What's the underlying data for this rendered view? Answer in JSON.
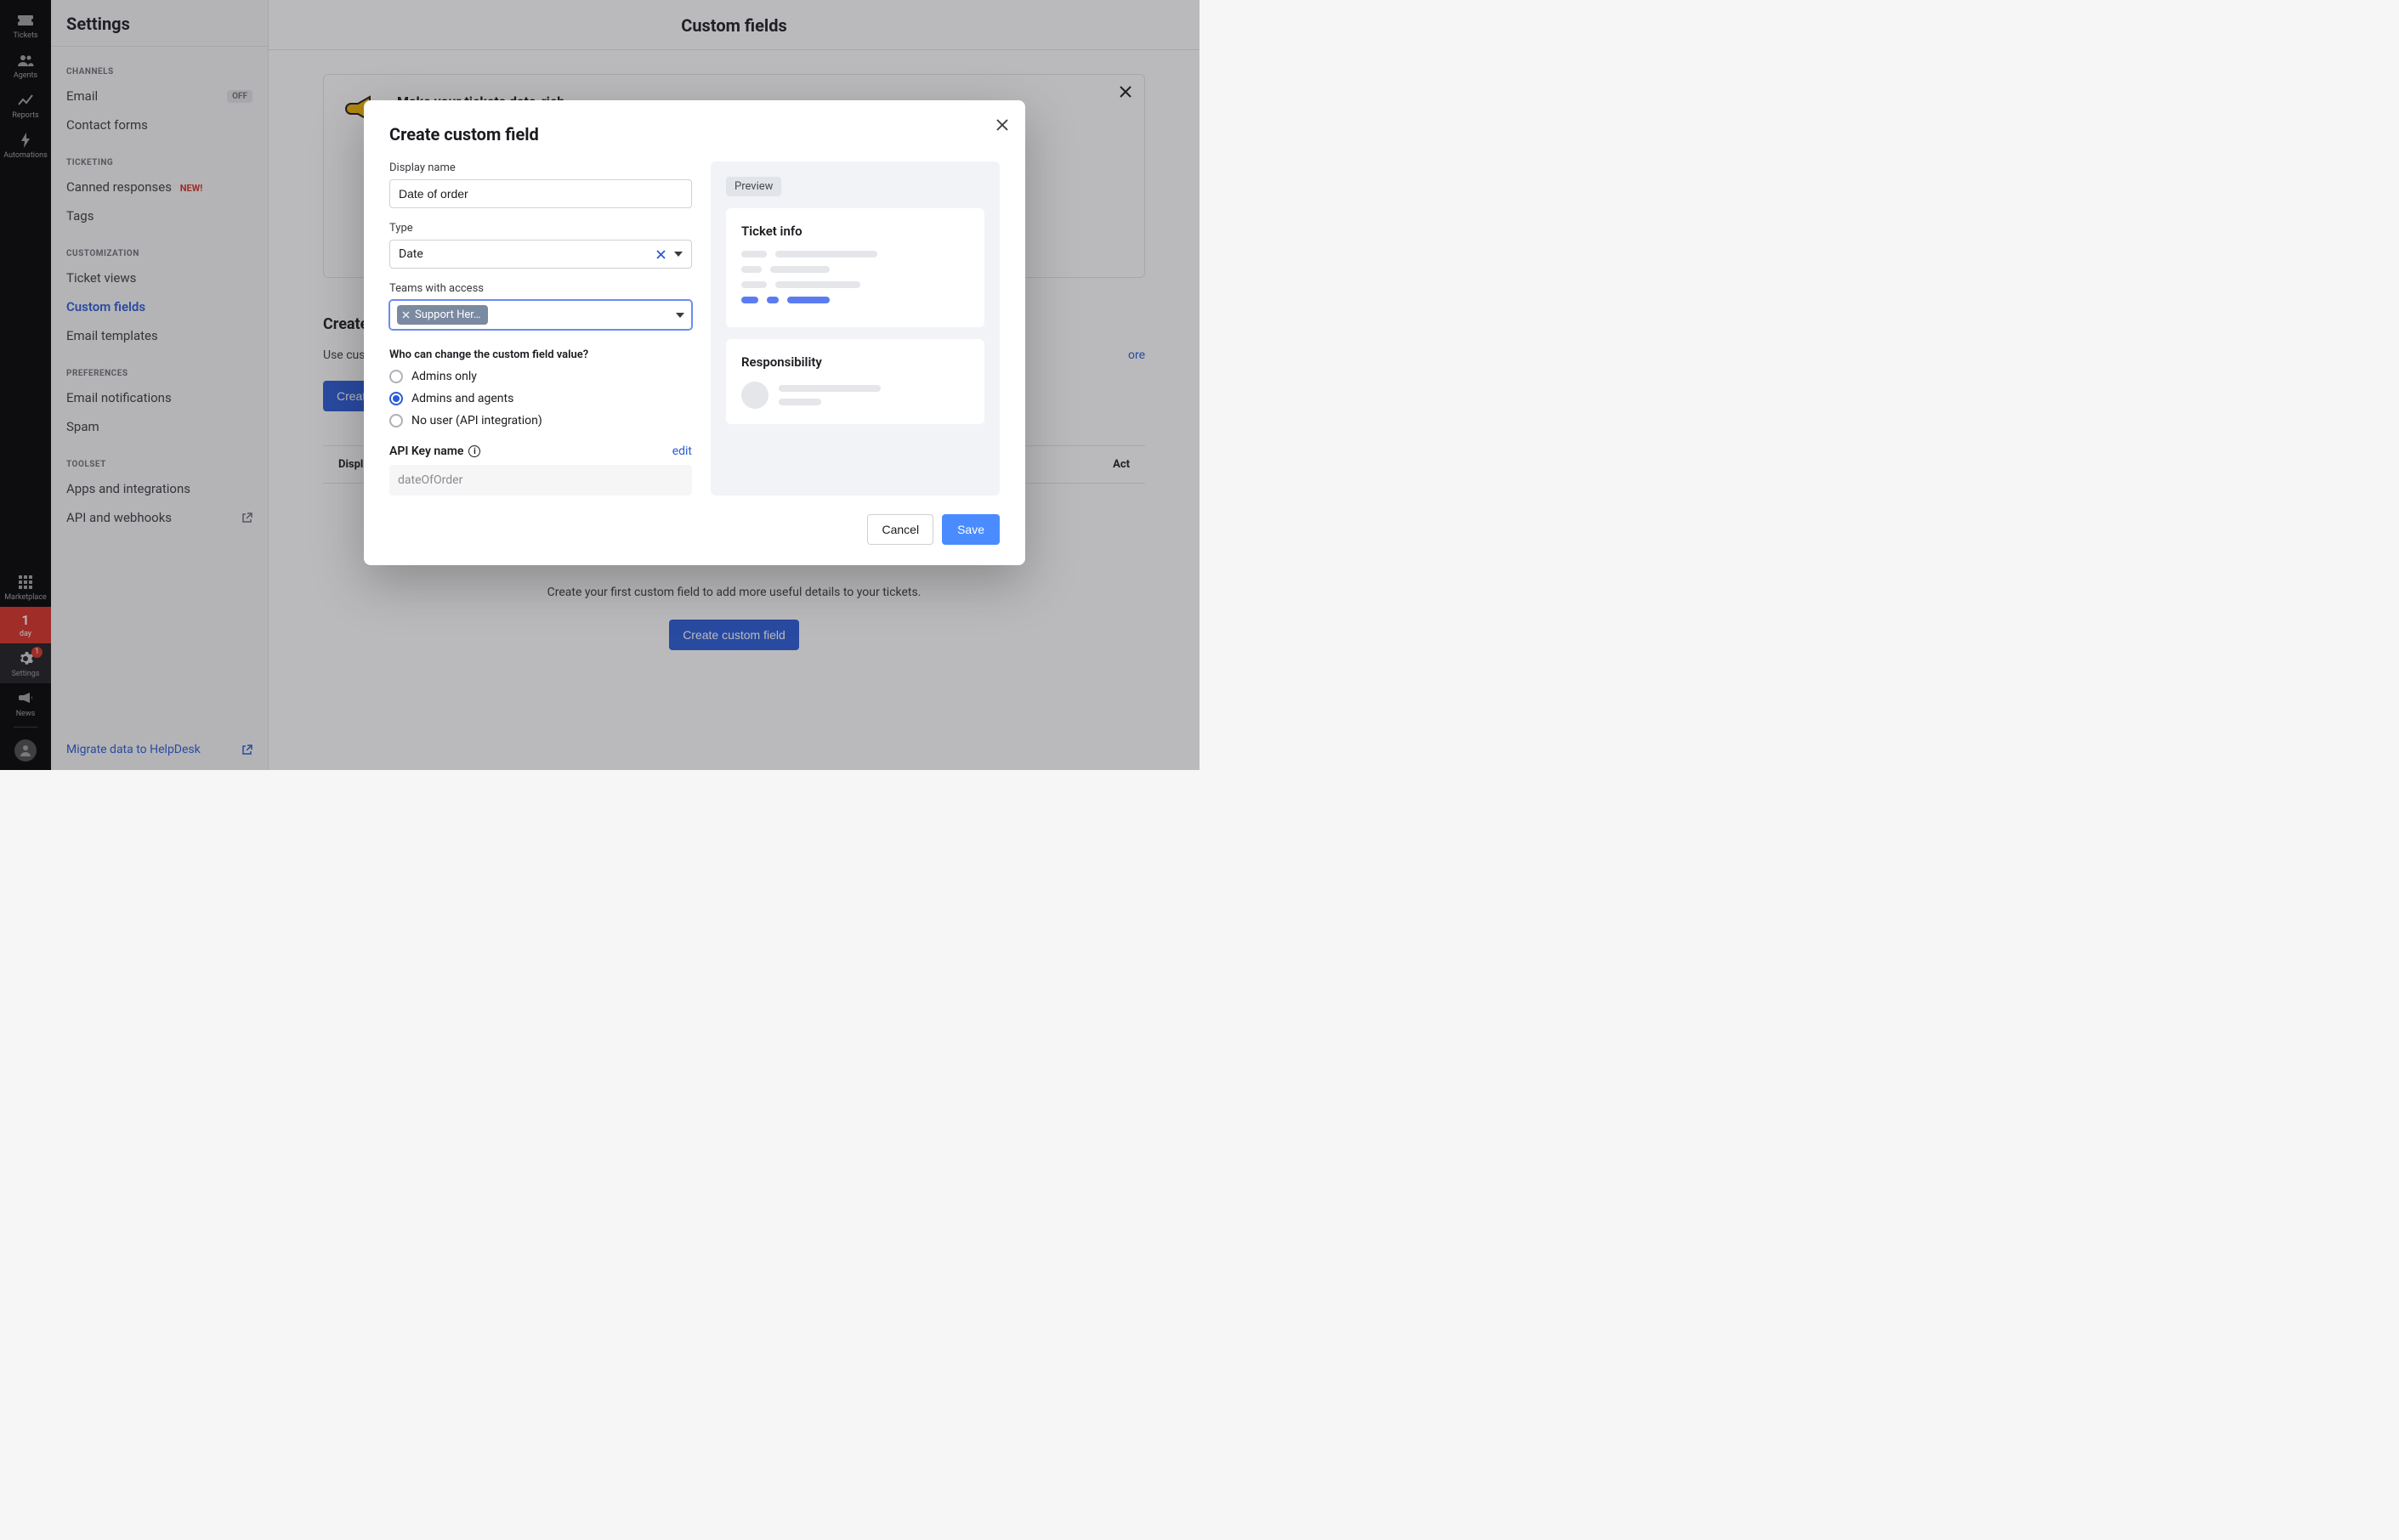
{
  "rail": {
    "items": [
      {
        "label": "Tickets"
      },
      {
        "label": "Agents"
      },
      {
        "label": "Reports"
      },
      {
        "label": "Automations"
      }
    ],
    "marketplace": "Marketplace",
    "trial_count": "1",
    "trial_unit": "day",
    "settings": "Settings",
    "settings_badge": "1",
    "news": "News"
  },
  "sidebar": {
    "title": "Settings",
    "groups": {
      "channels": {
        "label": "CHANNELS",
        "items": [
          {
            "label": "Email",
            "badge_off": "OFF"
          },
          {
            "label": "Contact forms"
          }
        ]
      },
      "ticketing": {
        "label": "TICKETING",
        "items": [
          {
            "label": "Canned responses",
            "badge_new": "NEW!"
          },
          {
            "label": "Tags"
          }
        ]
      },
      "customization": {
        "label": "CUSTOMIZATION",
        "items": [
          {
            "label": "Ticket views"
          },
          {
            "label": "Custom fields"
          },
          {
            "label": "Email templates"
          }
        ]
      },
      "preferences": {
        "label": "PREFERENCES",
        "items": [
          {
            "label": "Email notifications"
          },
          {
            "label": "Spam"
          }
        ]
      },
      "toolset": {
        "label": "TOOLSET",
        "items": [
          {
            "label": "Apps and integrations"
          },
          {
            "label": "API and webhooks"
          }
        ]
      }
    },
    "footer": "Migrate data to HelpDesk"
  },
  "main": {
    "title": "Custom fields",
    "banner": {
      "title": "Make your tickets data-rich"
    },
    "section_title": "Create c",
    "section_desc": "Use custo",
    "learn_more": "ore",
    "create_btn": "Create",
    "table": {
      "col1": "Displ",
      "col2": "Act"
    },
    "empty": {
      "text": "Create your first custom field to add more useful details to your tickets.",
      "btn": "Create custom field"
    }
  },
  "modal": {
    "title": "Create custom field",
    "display_name_label": "Display name",
    "display_name_value": "Date of order",
    "type_label": "Type",
    "type_value": "Date",
    "teams_label": "Teams with access",
    "teams_chip": "Support Her…",
    "perm_label": "Who can change the custom field value?",
    "perm_options": [
      {
        "label": "Admins only",
        "checked": false
      },
      {
        "label": "Admins and agents",
        "checked": true
      },
      {
        "label": "No user (API integration)",
        "checked": false
      }
    ],
    "api_label": "API Key name",
    "api_edit": "edit",
    "api_value": "dateOfOrder",
    "preview_label": "Preview",
    "preview_card1_title": "Ticket info",
    "preview_card2_title": "Responsibility",
    "cancel": "Cancel",
    "save": "Save"
  }
}
